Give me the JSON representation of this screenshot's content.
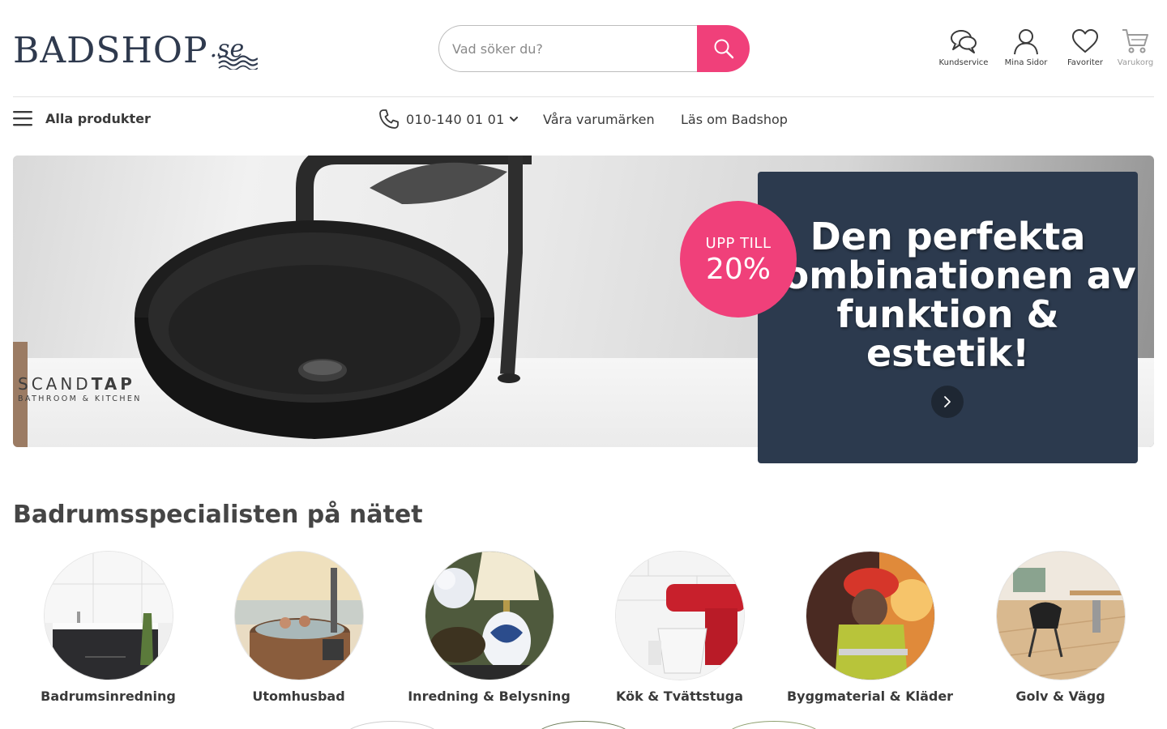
{
  "header": {
    "logo": {
      "main": "BADSHOP",
      "suffix": ".se"
    },
    "search": {
      "placeholder": "Vad söker du?"
    },
    "actions": [
      {
        "label": "Kundservice",
        "icon": "chat-bubbles-icon"
      },
      {
        "label": "Mina Sidor",
        "icon": "user-icon"
      },
      {
        "label": "Favoriter",
        "icon": "heart-icon"
      },
      {
        "label": "Varukorg",
        "icon": "cart-icon"
      }
    ]
  },
  "nav": {
    "all_products": "Alla produkter",
    "phone": "010-140 01 01",
    "brands": "Våra varumärken",
    "about": "Läs om Badshop"
  },
  "hero": {
    "brand": {
      "name_light": "SCAND",
      "name_bold": "TAP",
      "sub": "BATHROOM & KITCHEN"
    },
    "badge": {
      "top": "UPP TILL",
      "main": "20%"
    },
    "headline": "Den perfekta kombinationen av funktion & estetik!",
    "colors": {
      "panel": "#2c3a4e",
      "accent": "#f0407a"
    }
  },
  "section": {
    "title": "Badrumsspecialisten på nätet",
    "categories": [
      {
        "label": "Badrumsinredning"
      },
      {
        "label": "Utomhusbad"
      },
      {
        "label": "Inredning & Belysning"
      },
      {
        "label": "Kök & Tvättstuga"
      },
      {
        "label": "Byggmaterial & Kläder"
      },
      {
        "label": "Golv & Vägg"
      }
    ]
  }
}
